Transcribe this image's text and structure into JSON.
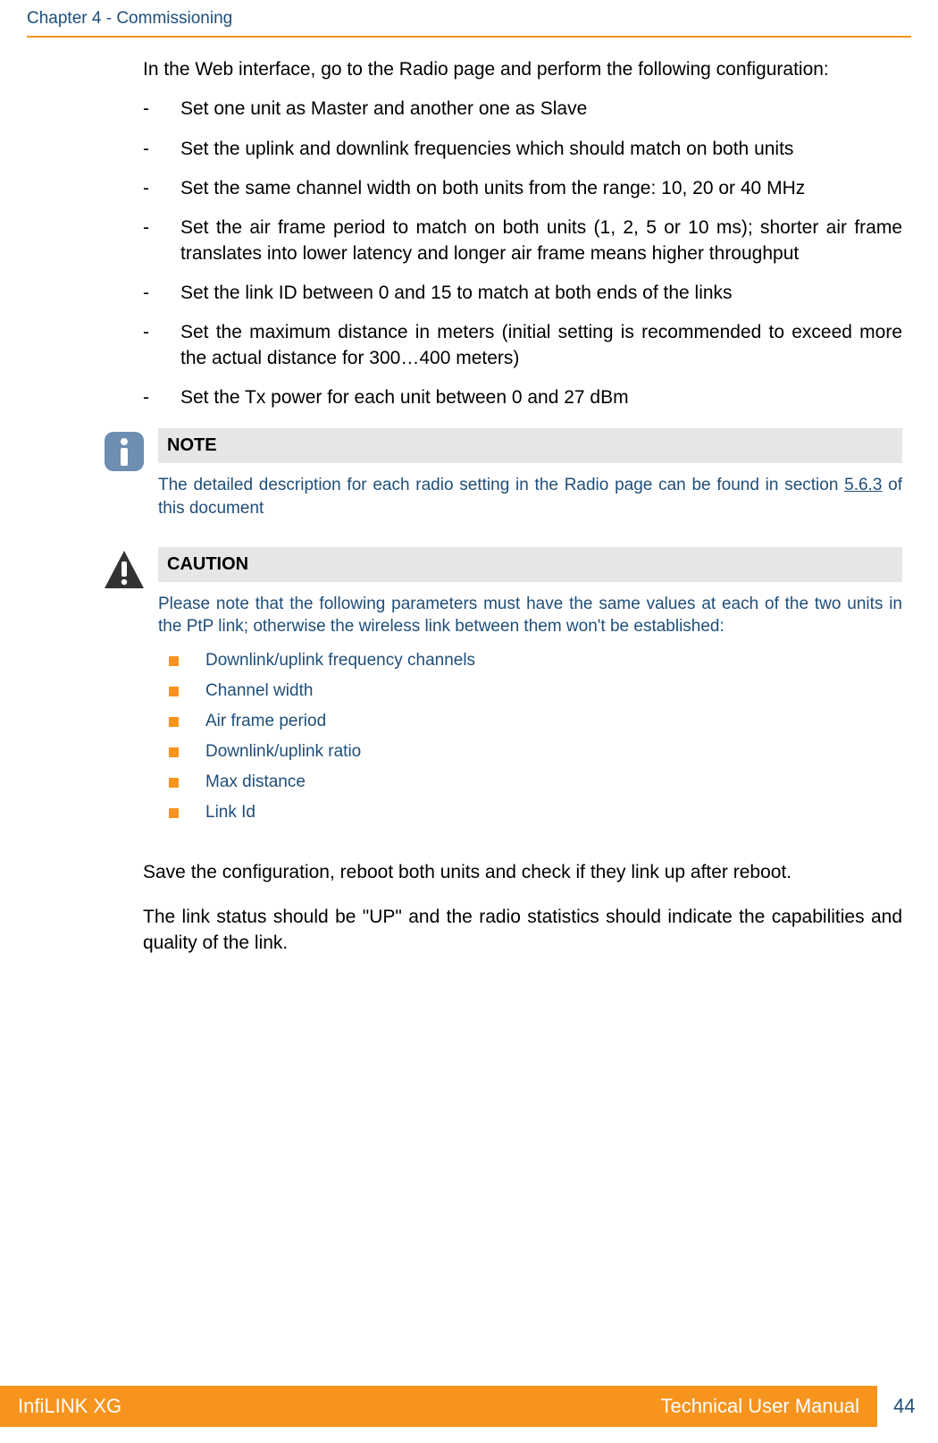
{
  "header": {
    "chapter": "Chapter 4 - Commissioning"
  },
  "intro": "In the Web interface, go to the Radio page and perform the following configuration:",
  "dash_items": [
    "Set one unit as Master and another one as Slave",
    "Set the uplink and downlink frequencies which should match on both units",
    "Set the same channel width on both units from the range: 10, 20 or 40 MHz",
    "Set the air frame period to match on both units (1, 2, 5 or 10 ms); shorter air frame translates into lower latency and longer air frame means higher throughput",
    "Set the link ID between 0 and 15 to match at both ends of the links",
    "Set the maximum distance in meters (initial setting is recommended to exceed more the actual distance for 300…400 meters)",
    "Set the Tx power for each unit between 0 and 27 dBm"
  ],
  "note": {
    "label": "NOTE",
    "text_pre": "The detailed description for each radio setting in the Radio page can be found in section ",
    "link": "5.6.3",
    "text_post": " of this document"
  },
  "caution": {
    "label": "CAUTION",
    "intro": "Please note that the following parameters must have the same values at each of the two units in the PtP link; otherwise the wireless link between them won't be established:",
    "items": [
      "Downlink/uplink frequency channels",
      "Channel width",
      "Air frame period",
      "Downlink/uplink ratio",
      "Max distance",
      "Link Id"
    ]
  },
  "after": [
    "Save the configuration, reboot both units and check if they link up after reboot.",
    "The link status should be \"UP\" and the radio statistics should indicate the capabilities and quality of the link."
  ],
  "footer": {
    "left": "InfiLINK XG",
    "right": "Technical User Manual",
    "page": "44"
  }
}
